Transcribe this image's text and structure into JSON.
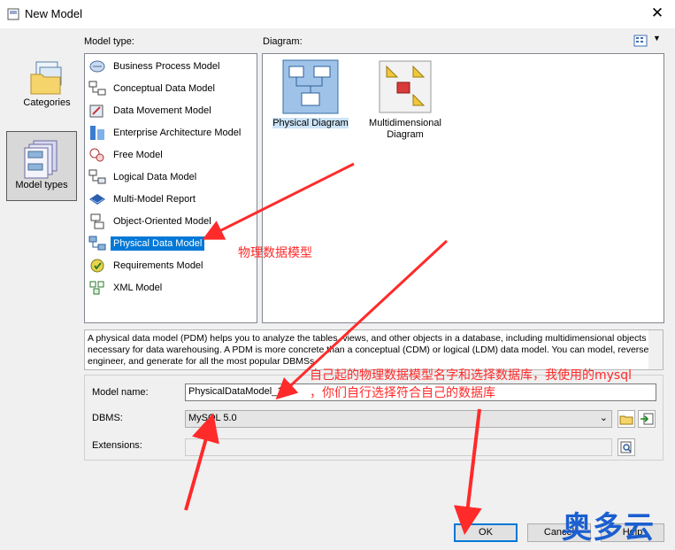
{
  "window": {
    "title": "New Model"
  },
  "categories": [
    {
      "label": "Categories",
      "icon": "folder-stack-icon"
    },
    {
      "label": "Model types",
      "icon": "model-types-icon"
    }
  ],
  "model_type_label": "Model type:",
  "diagram_label": "Diagram:",
  "model_types": [
    {
      "label": "Business Process Model",
      "icon": "business-process-icon"
    },
    {
      "label": "Conceptual Data Model",
      "icon": "conceptual-data-icon"
    },
    {
      "label": "Data Movement Model",
      "icon": "data-movement-icon"
    },
    {
      "label": "Enterprise Architecture Model",
      "icon": "enterprise-architecture-icon"
    },
    {
      "label": "Free Model",
      "icon": "free-model-icon"
    },
    {
      "label": "Logical Data Model",
      "icon": "logical-data-icon"
    },
    {
      "label": "Multi-Model Report",
      "icon": "report-icon"
    },
    {
      "label": "Object-Oriented Model",
      "icon": "object-oriented-icon"
    },
    {
      "label": "Physical Data Model",
      "icon": "physical-data-icon"
    },
    {
      "label": "Requirements Model",
      "icon": "requirements-icon"
    },
    {
      "label": "XML Model",
      "icon": "xml-icon"
    }
  ],
  "selected_model_type": "Physical Data Model",
  "diagrams": [
    {
      "label": "Physical Diagram",
      "icon": "physical-diagram-icon"
    },
    {
      "label": "Multidimensional Diagram",
      "icon": "multidimensional-diagram-icon"
    }
  ],
  "description": "A physical data model (PDM) helps you to analyze the tables, views, and other objects in a database, including multidimensional objects necessary for data warehousing. A PDM is more concrete than a conceptual (CDM) or logical (LDM) data model. You can model, reverse-engineer, and generate for all the most popular DBMSs.",
  "form": {
    "model_name_label": "Model name:",
    "model_name_value": "PhysicalDataModel_1",
    "dbms_label": "DBMS:",
    "dbms_value": "MySQL 5.0",
    "extensions_label": "Extensions:",
    "extensions_value": ""
  },
  "buttons": {
    "ok": "OK",
    "cancel": "Cancel",
    "help": "Help"
  },
  "annotations": {
    "physical_model_note": "物理数据模型",
    "name_note_line1": "自己起的物理数据模型名字和选择数据库，我使用的mysql",
    "name_note_line2": "，你们自行选择符合自己的数据库",
    "annotation_color": "#ff2a2a"
  },
  "watermark": "奥多云",
  "colors": {
    "selection": "#0078d7",
    "window_bg": "#f0f0f0"
  }
}
